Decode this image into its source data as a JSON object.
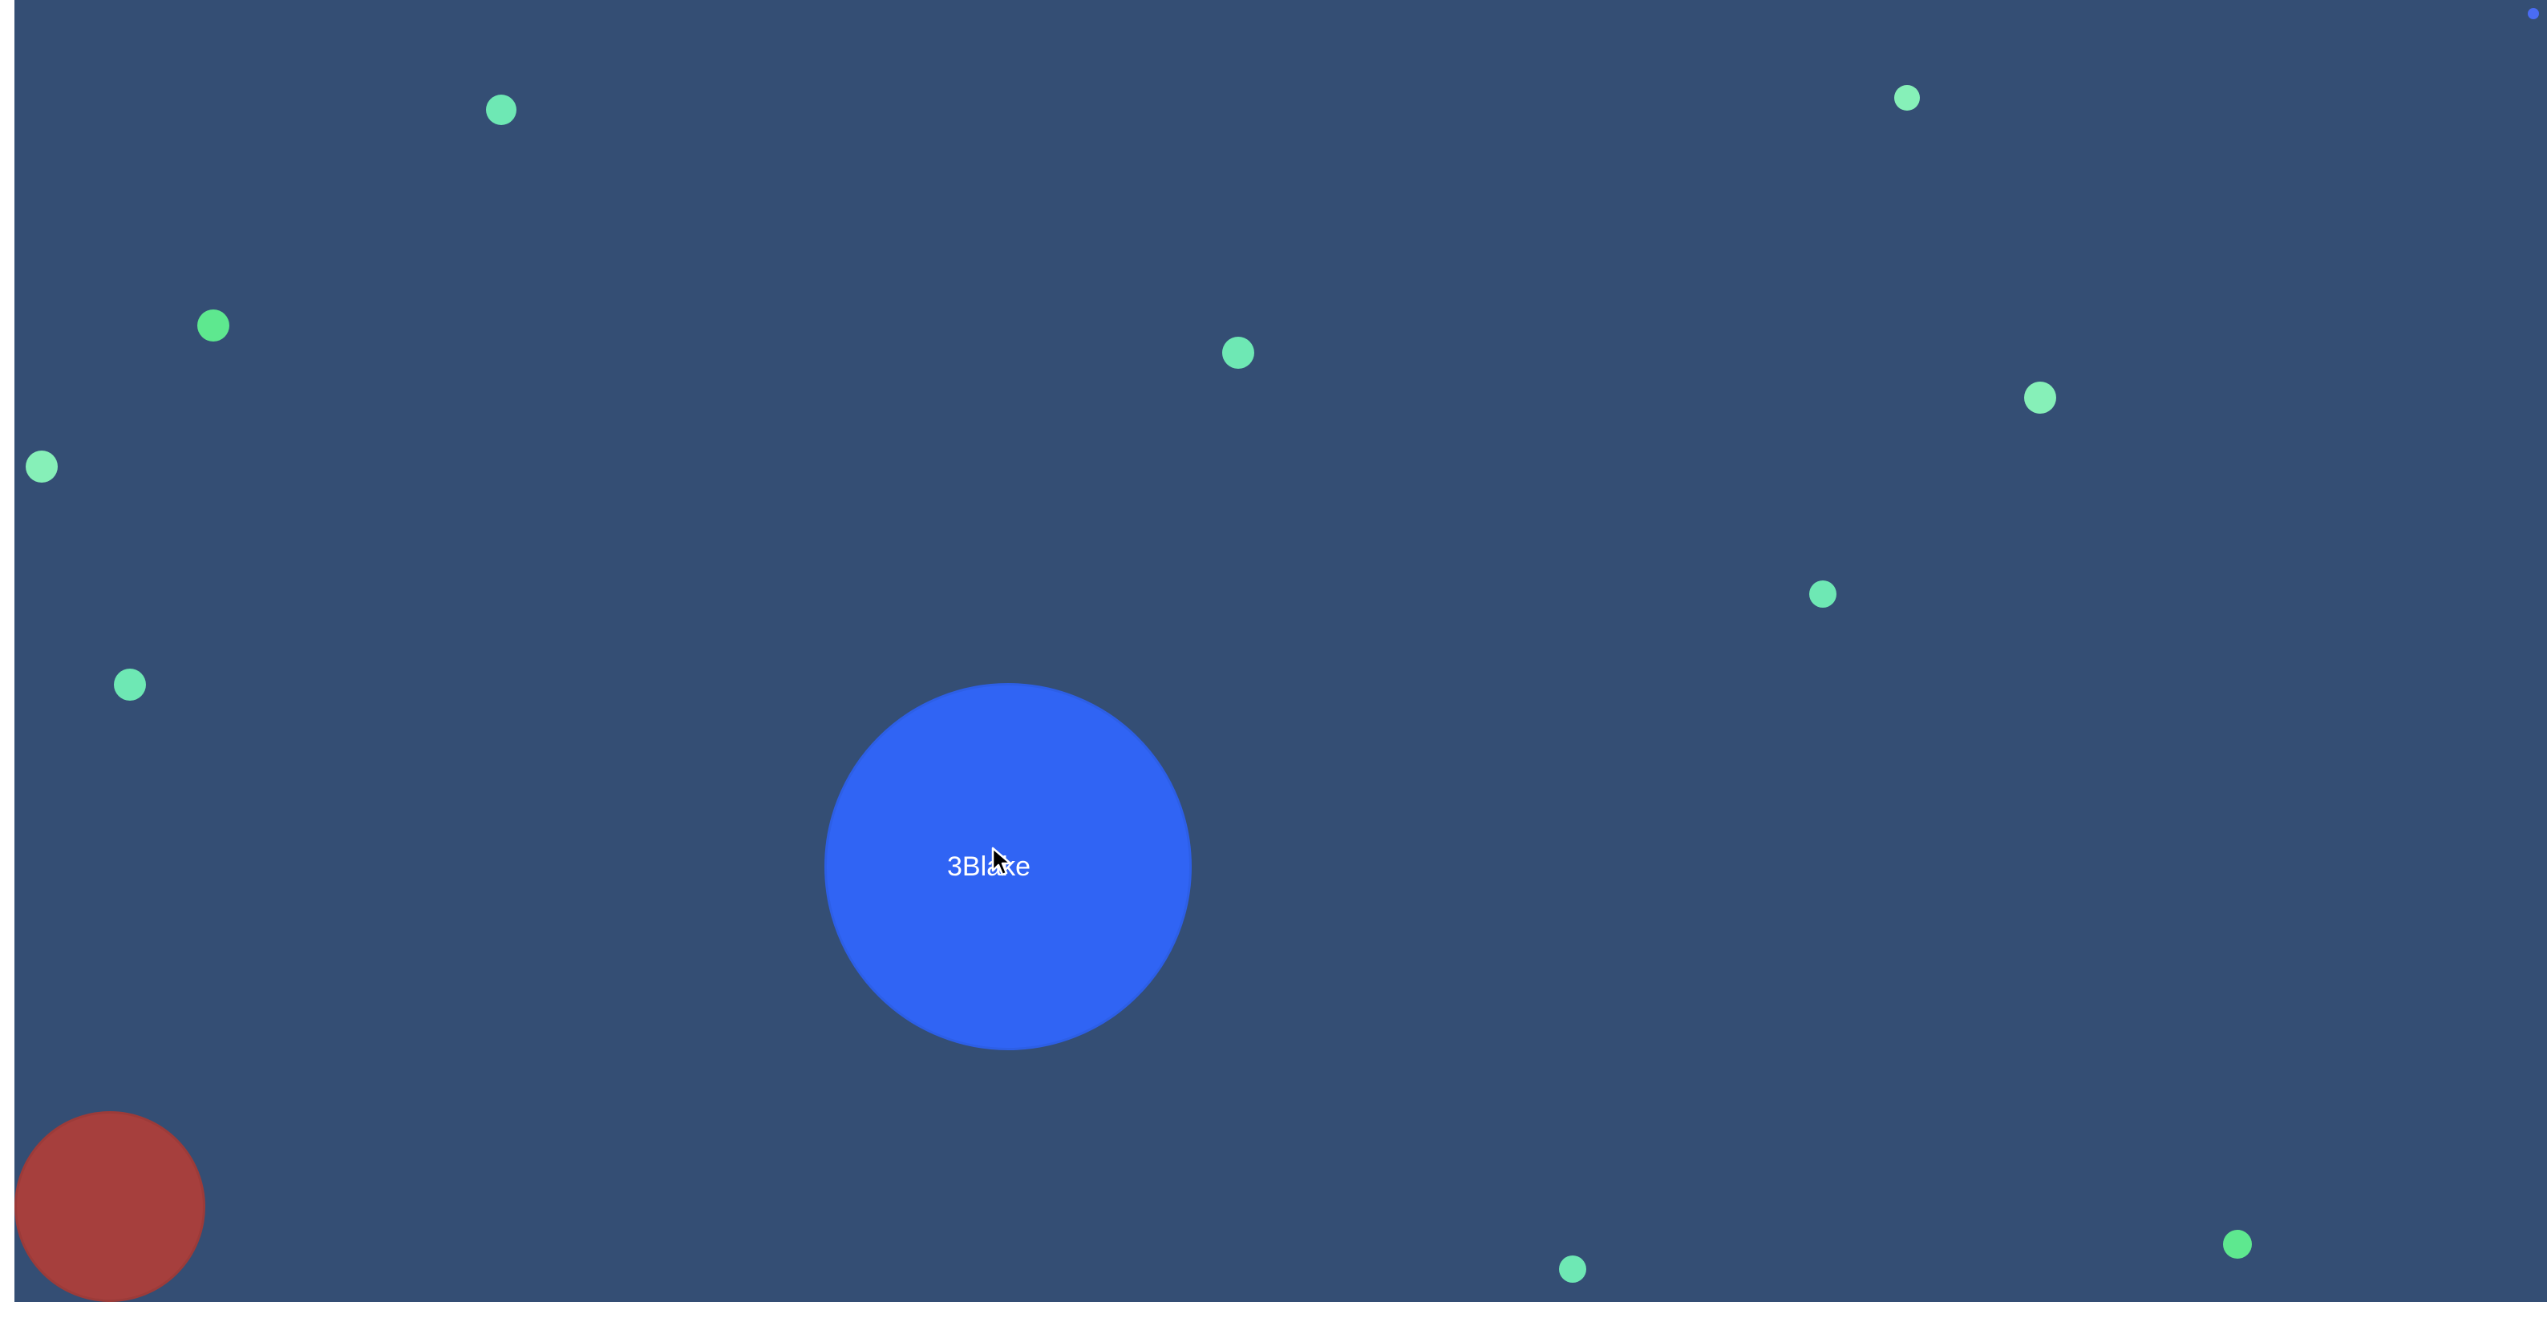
{
  "colors": {
    "background": "#344e74",
    "player_fill": "#3064f4",
    "player_border": "#2d5fe6",
    "enemy_fill": "#a63f3d",
    "enemy_border": "#9c3b39",
    "pellet_mint": "#6ee8b4",
    "pellet_green": "#5ee88f",
    "pellet_light": "#86f0b8",
    "corner_dot": "#4a6cf4"
  },
  "player": {
    "name": "3Blake"
  },
  "enemy": {
    "name": ""
  },
  "pellets": [
    {
      "color": "pellet_mint"
    },
    {
      "color": "pellet_light"
    },
    {
      "color": "pellet_green"
    },
    {
      "color": "pellet_mint"
    },
    {
      "color": "pellet_light"
    },
    {
      "color": "pellet_light"
    },
    {
      "color": "pellet_mint"
    },
    {
      "color": "pellet_mint"
    },
    {
      "color": "pellet_mint"
    },
    {
      "color": "pellet_green"
    }
  ],
  "icons": {
    "cursor": "mouse-pointer-icon"
  }
}
